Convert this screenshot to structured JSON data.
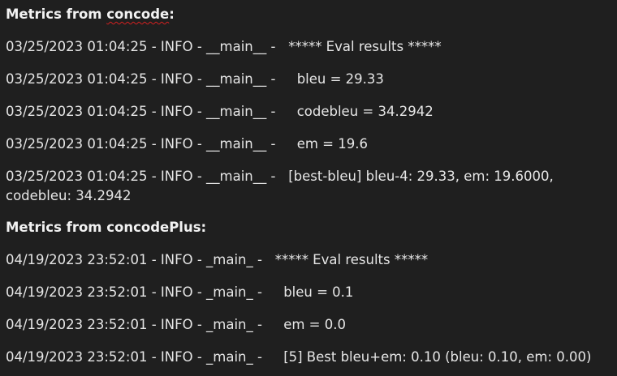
{
  "sections": [
    {
      "heading_prefix": "Metrics from ",
      "heading_name": "concode",
      "heading_suffix": ":",
      "lines": [
        {
          "prefix": "03/25/2023 01:04:25 - INFO - __main__ -   ",
          "message": "***** Eval results *****"
        },
        {
          "prefix": "03/25/2023 01:04:25 - INFO - __main__ -     ",
          "message": "bleu = 29.33"
        },
        {
          "prefix": "03/25/2023 01:04:25 - INFO - __main__ -     ",
          "message": "codebleu = 34.2942"
        },
        {
          "prefix": "03/25/2023 01:04:25 - INFO - __main__ -     ",
          "message": "em = 19.6"
        },
        {
          "prefix": "03/25/2023 01:04:25 - INFO - __main__ -   ",
          "message": "[best-bleu] bleu-4: 29.33, em: 19.6000,",
          "continuation": "codebleu: 34.2942"
        }
      ]
    },
    {
      "heading_prefix": "Metrics from ",
      "heading_name": "concodePlus",
      "heading_suffix": ":",
      "lines": [
        {
          "prefix": "04/19/2023 23:52:01 - INFO - _main_ -   ",
          "message": "***** Eval results *****"
        },
        {
          "prefix": "04/19/2023 23:52:01 - INFO - _main_ -     ",
          "message": "bleu = 0.1"
        },
        {
          "prefix": "04/19/2023 23:52:01 - INFO - _main_ -     ",
          "message": "em = 0.0"
        },
        {
          "prefix": "04/19/2023 23:52:01 - INFO - _main_ -     ",
          "message": "[5] Best bleu+em: 0.10 (bleu: 0.10, em: 0.00)"
        }
      ]
    }
  ]
}
